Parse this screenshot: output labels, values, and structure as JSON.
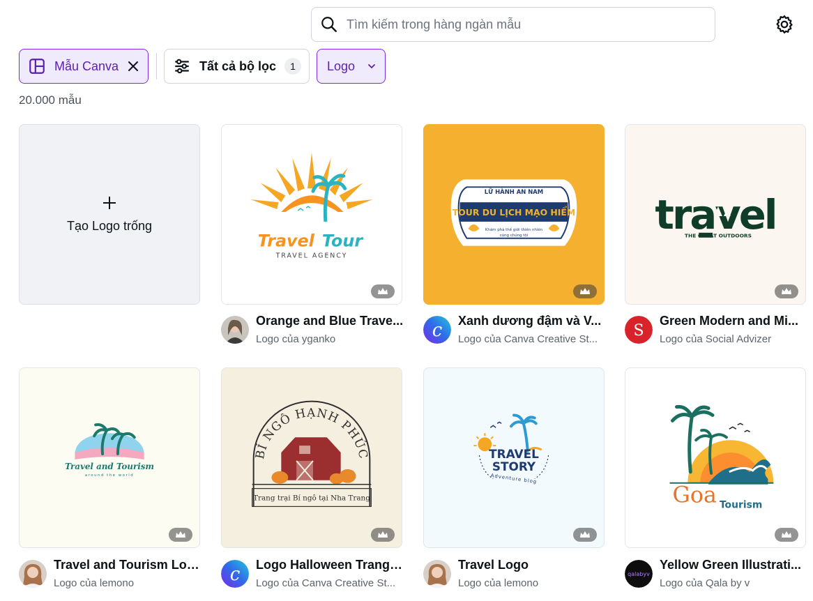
{
  "search": {
    "placeholder": "Tìm kiếm trong hàng ngàn mẫu"
  },
  "filters": {
    "canva_chip": "Mẫu Canva",
    "all_filters": "Tất cả bộ lọc",
    "all_filters_count": "1",
    "type_chip": "Logo"
  },
  "results_count": "20.000 mẫu",
  "blank_card": {
    "label": "Tạo Logo trống"
  },
  "templates": [
    {
      "title": "Orange and Blue Trave...",
      "author": "Logo của yganko",
      "art": {
        "line1": "Travel",
        "line2": "Tour",
        "line3": "TRAVEL AGENCY"
      }
    },
    {
      "title": "Xanh dương đậm và V...",
      "author": "Logo của Canva Creative St...",
      "art": {
        "line1": "LỮ HÀNH AN NAM",
        "line2": "TOUR DU LỊCH MẠO HIỂM",
        "line3": "Khám phá thế giới thiên nhiên",
        "line4": "cùng chúng tôi"
      }
    },
    {
      "title": "Green Modern and Mi...",
      "author": "Logo của Social Advizer",
      "art": {
        "line1": "travel",
        "line2": "THE GREAT OUTDOORS"
      }
    },
    {
      "title": "Travel and Tourism Logo",
      "author": "Logo của lemono",
      "art": {
        "line1": "Travel and Tourism",
        "line2": "around the world"
      }
    },
    {
      "title": "Logo Halloween Trang ...",
      "author": "Logo của Canva Creative St...",
      "art": {
        "line1": "BÍ NGÔ HẠNH PHÚC",
        "line2": "Trang trại Bí ngô tại Nha Trang"
      }
    },
    {
      "title": "Travel Logo",
      "author": "Logo của lemono",
      "art": {
        "line1": "TRAVEL",
        "line2": "STORY",
        "line3": "Adventure blog"
      }
    },
    {
      "title": "Yellow Green Illustrati...",
      "author": "Logo của Qala by v",
      "art": {
        "line1": "Goa",
        "line2": "Tourism"
      },
      "avatar_text": "qalabyv"
    }
  ],
  "colors": {
    "accent": "#7d2ae8",
    "accent_bg": "#f0eafd",
    "orange_card": "#f6b030",
    "navy": "#1f3a6e"
  }
}
